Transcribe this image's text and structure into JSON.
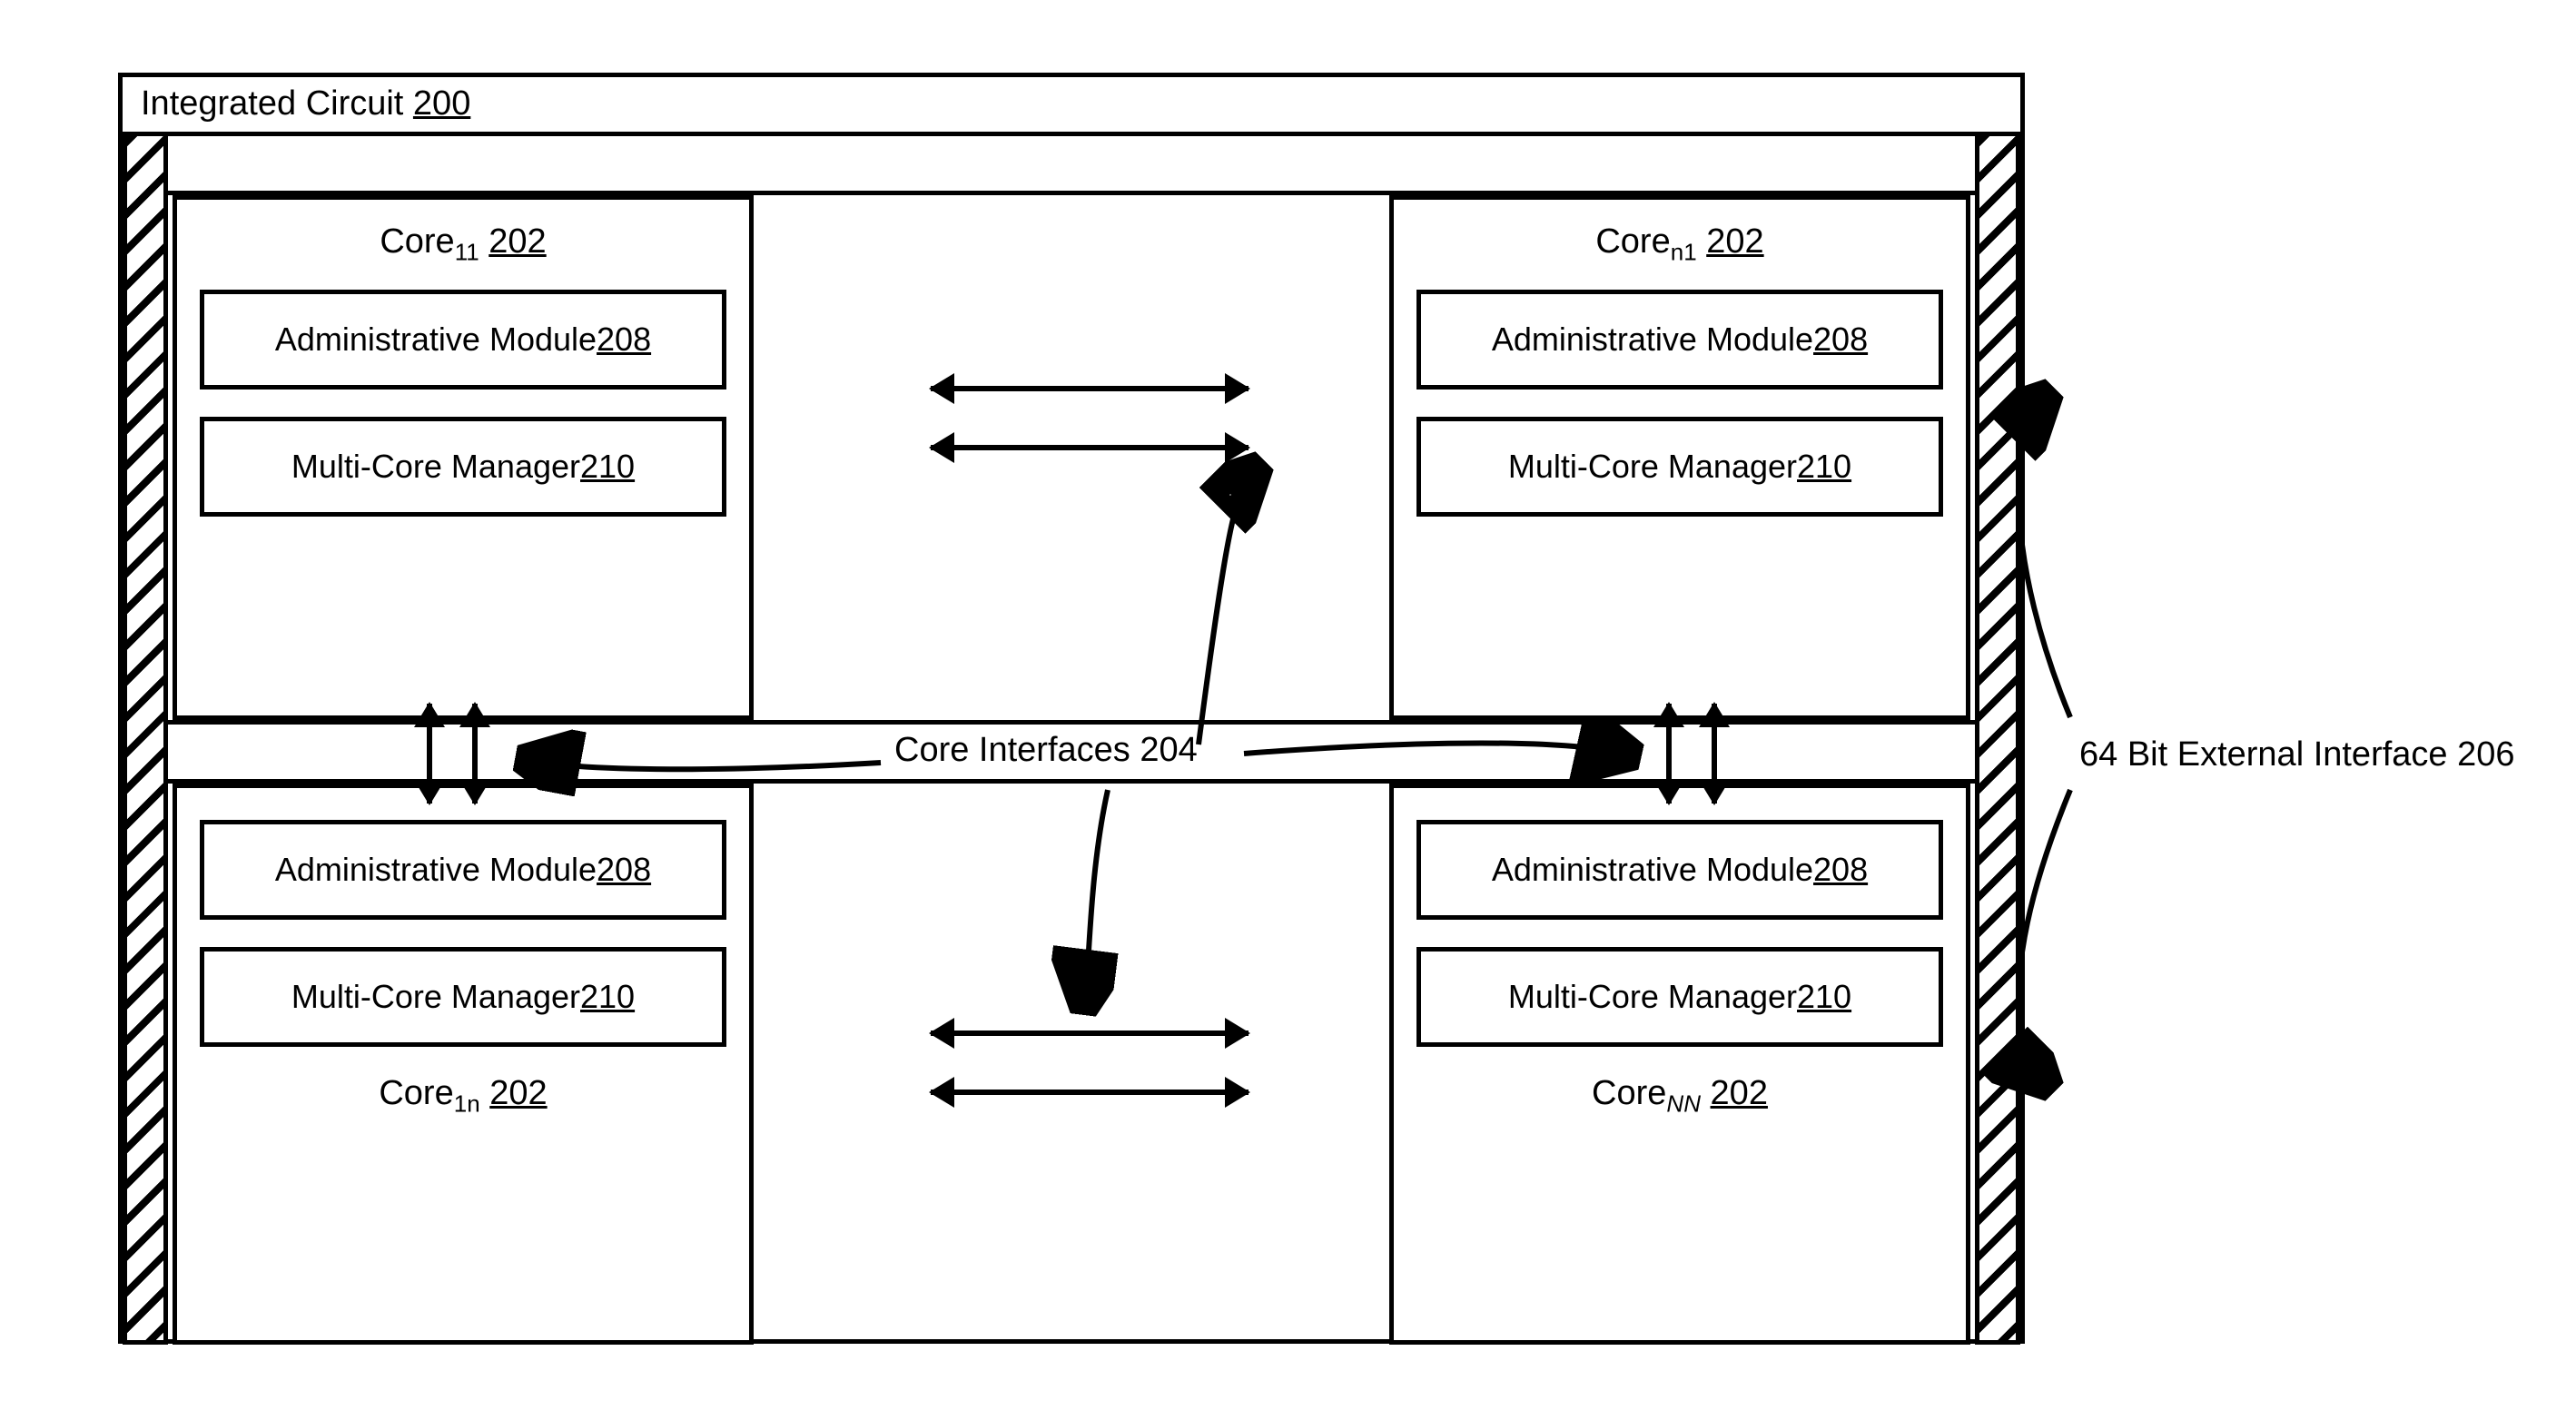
{
  "ic": {
    "title_prefix": "Integrated Circuit ",
    "title_ref": "200"
  },
  "core_label": {
    "prefix": "Core",
    "ref": "202",
    "sub_tl": "11",
    "sub_tr": "n1",
    "sub_bl": "1n",
    "sub_br": "NN"
  },
  "modules": {
    "admin_prefix": "Administrative Module ",
    "admin_ref": "208",
    "mgr_prefix": "Multi-Core Manager ",
    "mgr_ref": "210"
  },
  "interfaces": {
    "core_label": "Core Interfaces 204",
    "ext_label": "64 Bit External Interface 206"
  }
}
